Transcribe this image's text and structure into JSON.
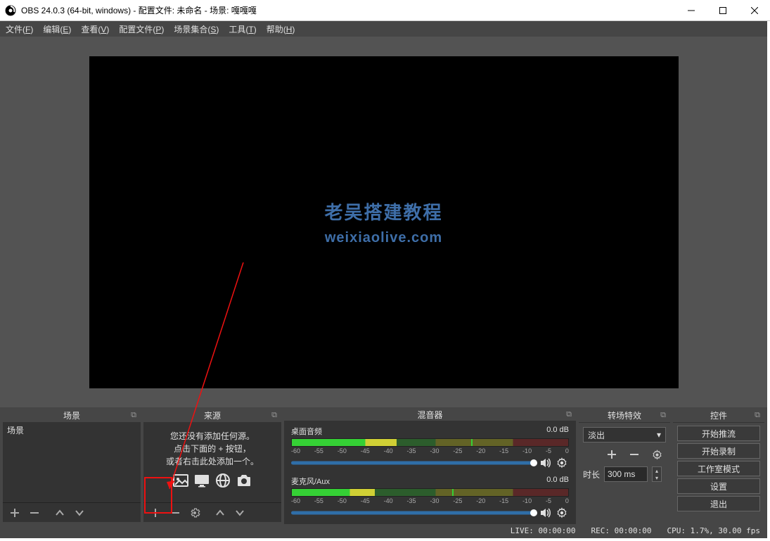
{
  "title": "OBS 24.0.3 (64-bit, windows) - 配置文件: 未命名 - 场景: 嘎嘎嘎",
  "menu": {
    "file": "文件(",
    "file_hk": "F",
    "file2": ")",
    "edit": "编辑(",
    "edit_hk": "E",
    "edit2": ")",
    "view": "查看(",
    "view_hk": "V",
    "view2": ")",
    "profile": "配置文件(",
    "profile_hk": "P",
    "profile2": ")",
    "scene_col": "场景集合(",
    "scene_col_hk": "S",
    "scene_col2": ")",
    "tools": "工具(",
    "tools_hk": "T",
    "tools2": ")",
    "help": "帮助(",
    "help_hk": "H",
    "help2": ")"
  },
  "watermark": {
    "line1": "老吴搭建教程",
    "line2": "weixiaolive.com"
  },
  "docks": {
    "scenes": {
      "title": "场景",
      "item": "场景"
    },
    "sources": {
      "title": "来源",
      "empty1": "您还没有添加任何源。",
      "empty2": "点击下面的 + 按钮，",
      "empty3": "或者右击此处添加一个。"
    },
    "mixer": {
      "title": "混音器",
      "ch1_name": "桌面音频",
      "ch1_db": "0.0 dB",
      "ch2_name": "麦克风/Aux",
      "ch2_db": "0.0 dB",
      "ticks": [
        "-60",
        "-55",
        "-50",
        "-45",
        "-40",
        "-35",
        "-30",
        "-25",
        "-20",
        "-15",
        "-10",
        "-5",
        "0"
      ]
    },
    "transitions": {
      "title": "转场特效",
      "fade": "淡出",
      "duration_label": "时长",
      "duration_val": "300 ms"
    },
    "controls": {
      "title": "控件",
      "start_stream": "开始推流",
      "start_record": "开始录制",
      "studio_mode": "工作室模式",
      "settings": "设置",
      "exit": "退出"
    }
  },
  "status": {
    "live": "LIVE: 00:00:00",
    "rec": "REC: 00:00:00",
    "cpu": "CPU: 1.7%, 30.00 fps"
  }
}
